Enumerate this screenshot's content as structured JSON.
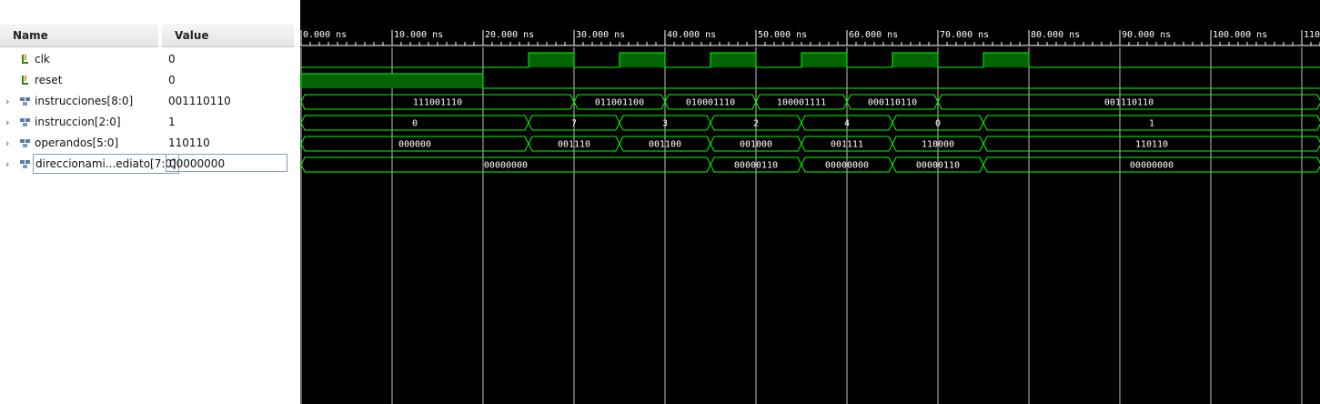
{
  "headers": {
    "name": "Name",
    "value": "Value"
  },
  "signals": [
    {
      "name": "clk",
      "value": "0",
      "type": "bit",
      "expandable": false
    },
    {
      "name": "reset",
      "value": "0",
      "type": "bit",
      "expandable": false
    },
    {
      "name": "instrucciones[8:0]",
      "value": "001110110",
      "type": "bus",
      "expandable": true
    },
    {
      "name": "instruccion[2:0]",
      "value": "1",
      "type": "bus",
      "expandable": true
    },
    {
      "name": "operandos[5:0]",
      "value": "110110",
      "type": "bus",
      "expandable": true
    },
    {
      "name": "direccionami...ediato[7:0]",
      "value": "00000000",
      "type": "bus",
      "expandable": true,
      "selected": true
    }
  ],
  "timeline": {
    "unit": "ns",
    "ticks": [
      "0.000 ns",
      "10.000 ns",
      "20.000 ns",
      "30.000 ns",
      "40.000 ns",
      "50.000 ns",
      "60.000 ns",
      "70.000 ns",
      "80.000 ns",
      "90.000 ns",
      "100.000 ns",
      "110"
    ],
    "view_start_ns": 0,
    "view_end_ns": 112.1
  },
  "waveforms": {
    "clk": {
      "high_intervals_ns": [
        [
          25,
          30
        ],
        [
          35,
          40
        ],
        [
          45,
          50
        ],
        [
          55,
          60
        ],
        [
          65,
          70
        ],
        [
          75,
          80
        ]
      ]
    },
    "reset": {
      "high_intervals_ns": [
        [
          0,
          20
        ]
      ]
    },
    "instrucciones[8:0]": [
      {
        "start": 0,
        "end": 30,
        "value": "111001110"
      },
      {
        "start": 30,
        "end": 40,
        "value": "011001100"
      },
      {
        "start": 40,
        "end": 50,
        "value": "010001110"
      },
      {
        "start": 50,
        "end": 60,
        "value": "100001111"
      },
      {
        "start": 60,
        "end": 70,
        "value": "000110110"
      },
      {
        "start": 70,
        "end": 112.1,
        "value": "001110110"
      }
    ],
    "instruccion[2:0]": [
      {
        "start": 0,
        "end": 25,
        "value": "0"
      },
      {
        "start": 25,
        "end": 35,
        "value": "7"
      },
      {
        "start": 35,
        "end": 45,
        "value": "3"
      },
      {
        "start": 45,
        "end": 55,
        "value": "2"
      },
      {
        "start": 55,
        "end": 65,
        "value": "4"
      },
      {
        "start": 65,
        "end": 75,
        "value": "0"
      },
      {
        "start": 75,
        "end": 112.1,
        "value": "1"
      }
    ],
    "operandos[5:0]": [
      {
        "start": 0,
        "end": 25,
        "value": "000000"
      },
      {
        "start": 25,
        "end": 35,
        "value": "001110"
      },
      {
        "start": 35,
        "end": 45,
        "value": "001100"
      },
      {
        "start": 45,
        "end": 55,
        "value": "001000"
      },
      {
        "start": 55,
        "end": 65,
        "value": "001111"
      },
      {
        "start": 65,
        "end": 75,
        "value": "110000"
      },
      {
        "start": 75,
        "end": 112.1,
        "value": "110110"
      }
    ],
    "direccionami...ediato[7:0]": [
      {
        "start": 0,
        "end": 45,
        "value": "00000000"
      },
      {
        "start": 45,
        "end": 55,
        "value": "00000110"
      },
      {
        "start": 55,
        "end": 65,
        "value": "00000000"
      },
      {
        "start": 65,
        "end": 75,
        "value": "00000110"
      },
      {
        "start": 75,
        "end": 112.1,
        "value": "00000000"
      }
    ]
  },
  "colors": {
    "trace": "#00ff00",
    "fill": "#006400",
    "grid": "#bfbfbf",
    "background": "#000000"
  }
}
